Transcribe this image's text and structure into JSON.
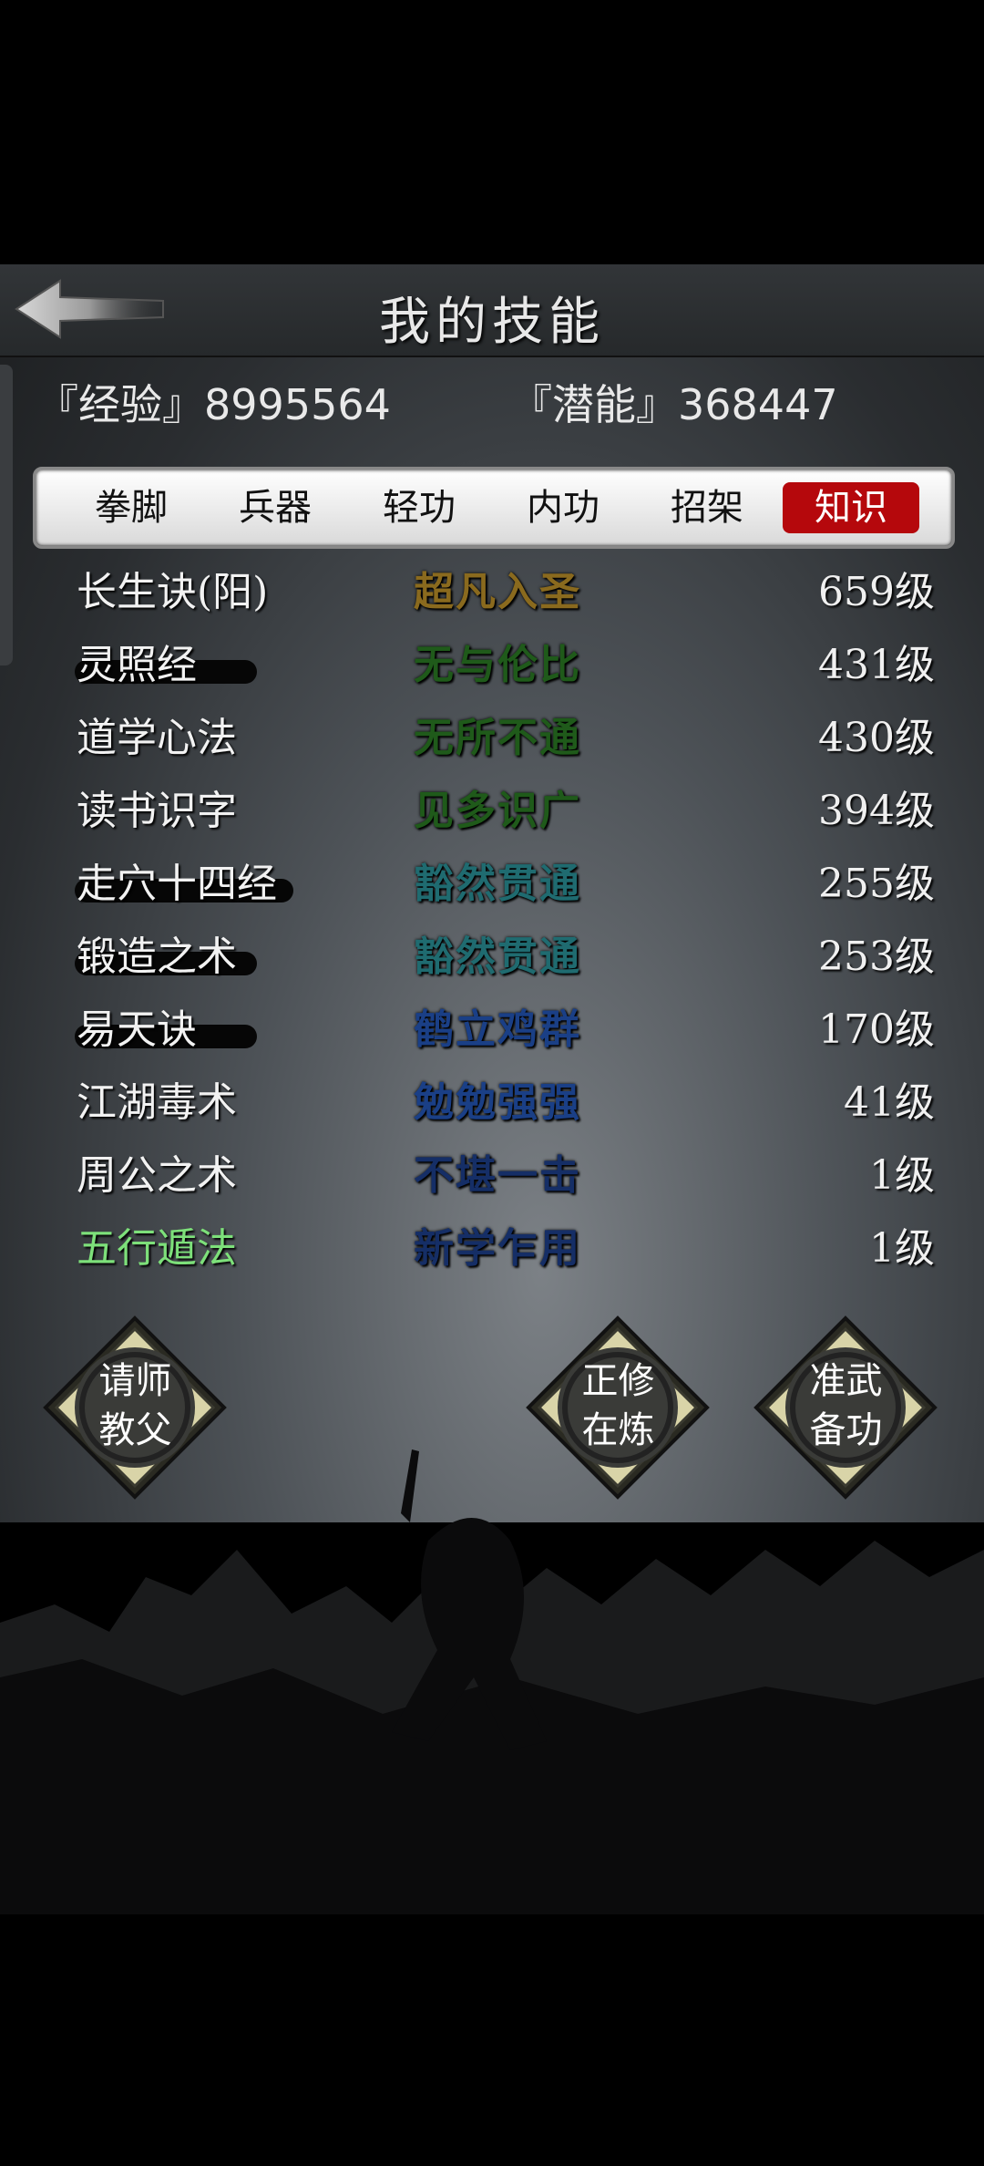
{
  "header": {
    "title": "我的技能"
  },
  "stats": {
    "exp_label": "『经验』",
    "exp_value": "8995564",
    "pot_label": "『潜能』",
    "pot_value": "368447"
  },
  "tabs": [
    {
      "label": "拳脚",
      "active": false
    },
    {
      "label": "兵器",
      "active": false
    },
    {
      "label": "轻功",
      "active": false
    },
    {
      "label": "内功",
      "active": false
    },
    {
      "label": "招架",
      "active": false
    },
    {
      "label": "知识",
      "active": true
    }
  ],
  "skills": [
    {
      "name": "长生诀(阳)",
      "rank": "超凡入圣",
      "level": "659级",
      "name_color": "#f2f2f2",
      "rank_color": "#8a6a1e",
      "brush": false
    },
    {
      "name": "灵照经",
      "rank": "无与伦比",
      "level": "431级",
      "name_color": "#f2f2f2",
      "rank_color": "#1f5a1a",
      "brush": true
    },
    {
      "name": "道学心法",
      "rank": "无所不通",
      "level": "430级",
      "name_color": "#f2f2f2",
      "rank_color": "#1f5a1a",
      "brush": false
    },
    {
      "name": "读书识字",
      "rank": "见多识广",
      "level": "394级",
      "name_color": "#f2f2f2",
      "rank_color": "#1f5a1a",
      "brush": false
    },
    {
      "name": "走穴十四经",
      "rank": "豁然贯通",
      "level": "255级",
      "name_color": "#f2f2f2",
      "rank_color": "#1f6b70",
      "brush": true
    },
    {
      "name": "锻造之术",
      "rank": "豁然贯通",
      "level": "253级",
      "name_color": "#f2f2f2",
      "rank_color": "#1f6b70",
      "brush": true
    },
    {
      "name": "易天诀",
      "rank": "鹤立鸡群",
      "level": "170级",
      "name_color": "#f2f2f2",
      "rank_color": "#1a3f86",
      "brush": true
    },
    {
      "name": "江湖毒术",
      "rank": "勉勉强强",
      "level": "41级",
      "name_color": "#f2f2f2",
      "rank_color": "#1a3f86",
      "brush": false
    },
    {
      "name": "周公之术",
      "rank": "不堪一击",
      "level": "1级",
      "name_color": "#f2f2f2",
      "rank_color": "#152e66",
      "brush": false
    },
    {
      "name": "五行遁法",
      "rank": "新学乍用",
      "level": "1级",
      "name_color": "#7de07a",
      "rank_color": "#152e66",
      "brush": false
    }
  ],
  "actions": [
    {
      "line1": "请师",
      "line2": "教父"
    },
    {
      "line1": "正修",
      "line2": "在炼"
    },
    {
      "line1": "准武",
      "line2": "备功"
    }
  ],
  "icons": {
    "back": "back-arrow-icon",
    "ornament": "diamond-medallion-icon"
  },
  "colors": {
    "active_tab": "#b5080c",
    "panel": "#4d5257"
  }
}
